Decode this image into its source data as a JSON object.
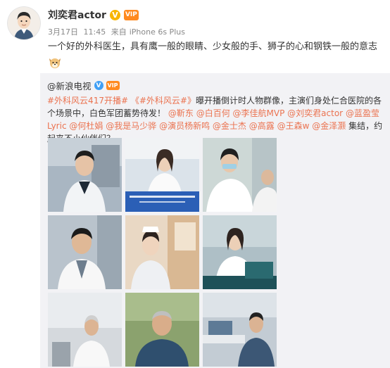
{
  "post": {
    "username": "刘奕君actor",
    "verified_badge": "V",
    "vip_badge": "VIP",
    "date": "3月17日",
    "time": "11:45",
    "source_prefix": "来自",
    "source_device": "iPhone 6s Plus",
    "content": "一个好的外科医生，具有鹰一般的眼睛、少女般的手、狮子的心和钢铁一般的意志",
    "emoji": "dog-emoji"
  },
  "repost": {
    "source_user": "@新浪电视",
    "verified_badge": "V",
    "vip_badge": "VIP",
    "text": {
      "tag1": "#外科风云417开播#",
      "tag2": "《#外科风云#》",
      "body1": "曝开播倒计时人物群像，主演们身处仁合医院的各个场景中，白色军团蓄势待发！",
      "mention1": "@靳东",
      "mention2": "@白百何",
      "mention3": "@李佳航MVP",
      "mention4": "@刘奕君actor",
      "mention5": "@蓝盈莹Lyric",
      "mention6": "@何杜娟",
      "mention7": "@我是马少骅",
      "mention8": "@演员杨新鸣",
      "mention9": "@金士杰",
      "mention10": "@高露",
      "mention11": "@王森w",
      "mention12": "@金泽灏",
      "body2": "集结，约起来不小伙伴们？"
    },
    "images": [
      {
        "name": "photo-1"
      },
      {
        "name": "photo-2"
      },
      {
        "name": "photo-3"
      },
      {
        "name": "photo-4"
      },
      {
        "name": "photo-5"
      },
      {
        "name": "photo-6"
      },
      {
        "name": "photo-7"
      },
      {
        "name": "photo-8"
      },
      {
        "name": "photo-9"
      }
    ]
  },
  "colors": {
    "link": "#eb7350",
    "repost_bg": "#f2f2f5",
    "meta": "#888888",
    "verified_gold": "#f8b500",
    "verified_blue": "#3f9ff5"
  }
}
